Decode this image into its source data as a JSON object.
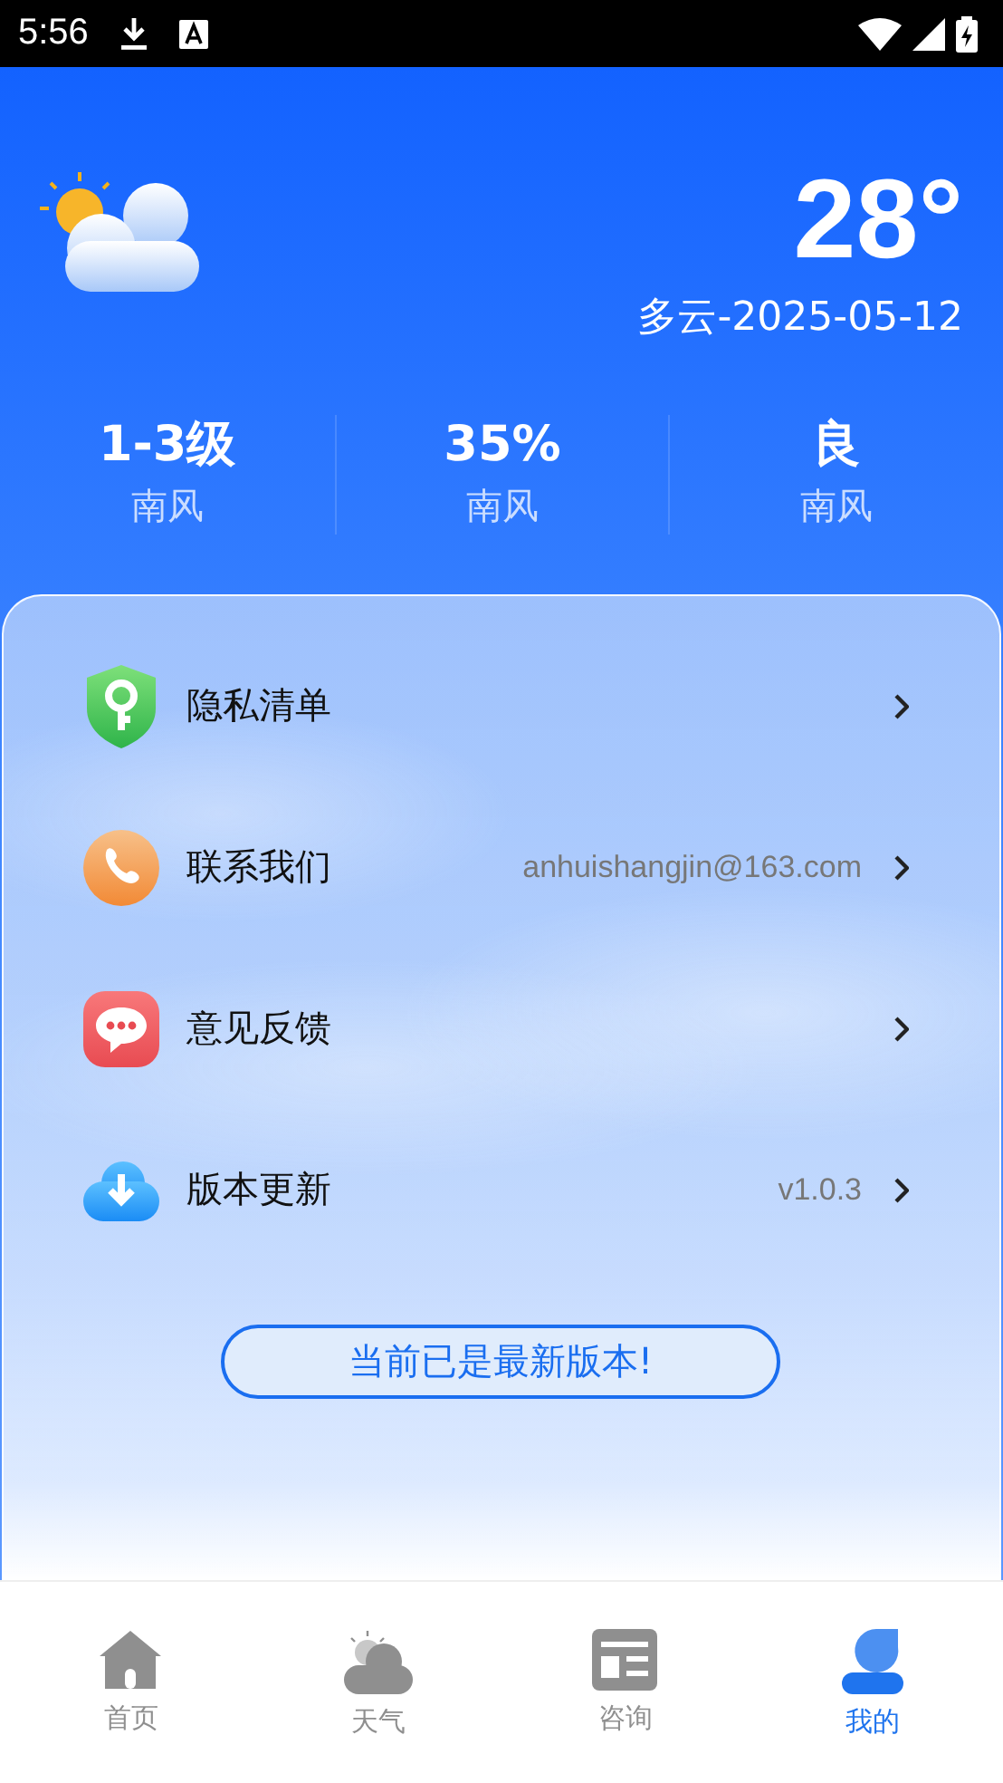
{
  "status_bar": {
    "time": "5:56"
  },
  "weather": {
    "temperature": "28°",
    "condition_date": "多云-2025-05-12",
    "stats": [
      {
        "value": "1-3级",
        "label": "南风"
      },
      {
        "value": "35%",
        "label": "南风"
      },
      {
        "value": "良",
        "label": "南风"
      }
    ]
  },
  "menu": [
    {
      "label": "隐私清单"
    },
    {
      "label": "联系我们",
      "value": "anhuishangjin@163.com"
    },
    {
      "label": "意见反馈"
    },
    {
      "label": "版本更新",
      "value": "v1.0.3"
    }
  ],
  "toast": "当前已是最新版本!",
  "tabs": [
    {
      "label": "首页",
      "selected": false
    },
    {
      "label": "天气",
      "selected": false
    },
    {
      "label": "咨询",
      "selected": false
    },
    {
      "label": "我的",
      "selected": true
    }
  ]
}
